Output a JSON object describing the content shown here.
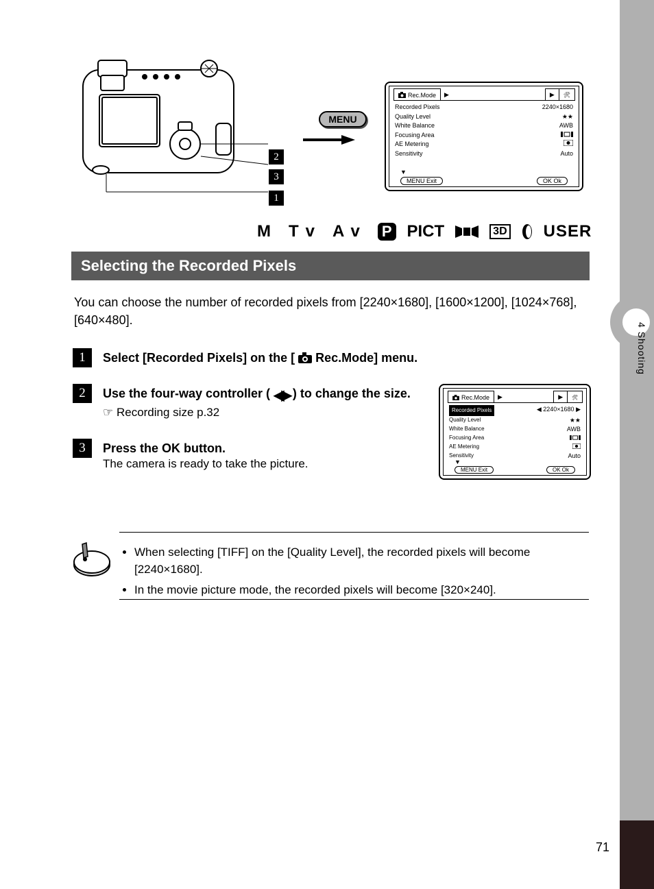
{
  "page_number": "71",
  "sidebar_text": "Shooting",
  "sidebar_num": "4",
  "menu_label": "MENU",
  "callouts": {
    "c1": "1",
    "c2": "2",
    "c3": "3"
  },
  "modes": {
    "m": "M",
    "tv": "Tv",
    "av": "Av",
    "p": "P",
    "pict": "PICT",
    "threed": "3D",
    "user": "USER"
  },
  "title": "Selecting the Recorded Pixels",
  "intro": "You can choose the number of recorded pixels from [2240×1680], [1600×1200], [1024×768], [640×480].",
  "steps": {
    "s1": {
      "num": "1",
      "text_a": "Select [Recorded Pixels] on the [",
      "text_b": " Rec.Mode] menu."
    },
    "s2": {
      "num": "2",
      "text_a": "Use the four-way controller (",
      "text_b": ") to change the size.",
      "sub": "☞ Recording size p.32"
    },
    "s3": {
      "num": "3",
      "text": "Press the OK button.",
      "sub": "The camera is ready to take the picture."
    }
  },
  "memo": {
    "b1": "When selecting [TIFF] on the [Quality Level], the recorded pixels will become [2240×1680].",
    "b2": "In the movie picture mode, the recorded pixels will become [320×240]."
  },
  "lcd1": {
    "tab1": "Rec.Mode",
    "rows": {
      "r1": {
        "label": "Recorded Pixels",
        "val": "2240×1680"
      },
      "r2": {
        "label": "Quality Level",
        "val": "★★"
      },
      "r3": {
        "label": "White Balance",
        "val": "AWB"
      },
      "r4": {
        "label": "Focusing Area",
        "val_pre": "",
        "val_post": ""
      },
      "r5": {
        "label": "AE Metering",
        "val": ""
      },
      "r6": {
        "label": "Sensitivity",
        "val": "Auto"
      }
    },
    "footer": {
      "exit": "MENU Exit",
      "ok": "OK Ok"
    }
  },
  "lcd2": {
    "tab1": "Rec.Mode",
    "rows": {
      "r1": {
        "label": "Recorded Pixels",
        "val": "2240×1680"
      },
      "r2": {
        "label": "Quality Level",
        "val": "★★"
      },
      "r3": {
        "label": "White Balance",
        "val": "AWB"
      },
      "r4": {
        "label": "Focusing Area"
      },
      "r5": {
        "label": "AE Metering"
      },
      "r6": {
        "label": "Sensitivity",
        "val": "Auto"
      }
    },
    "footer": {
      "exit": "MENU Exit",
      "ok": "OK Ok"
    }
  }
}
